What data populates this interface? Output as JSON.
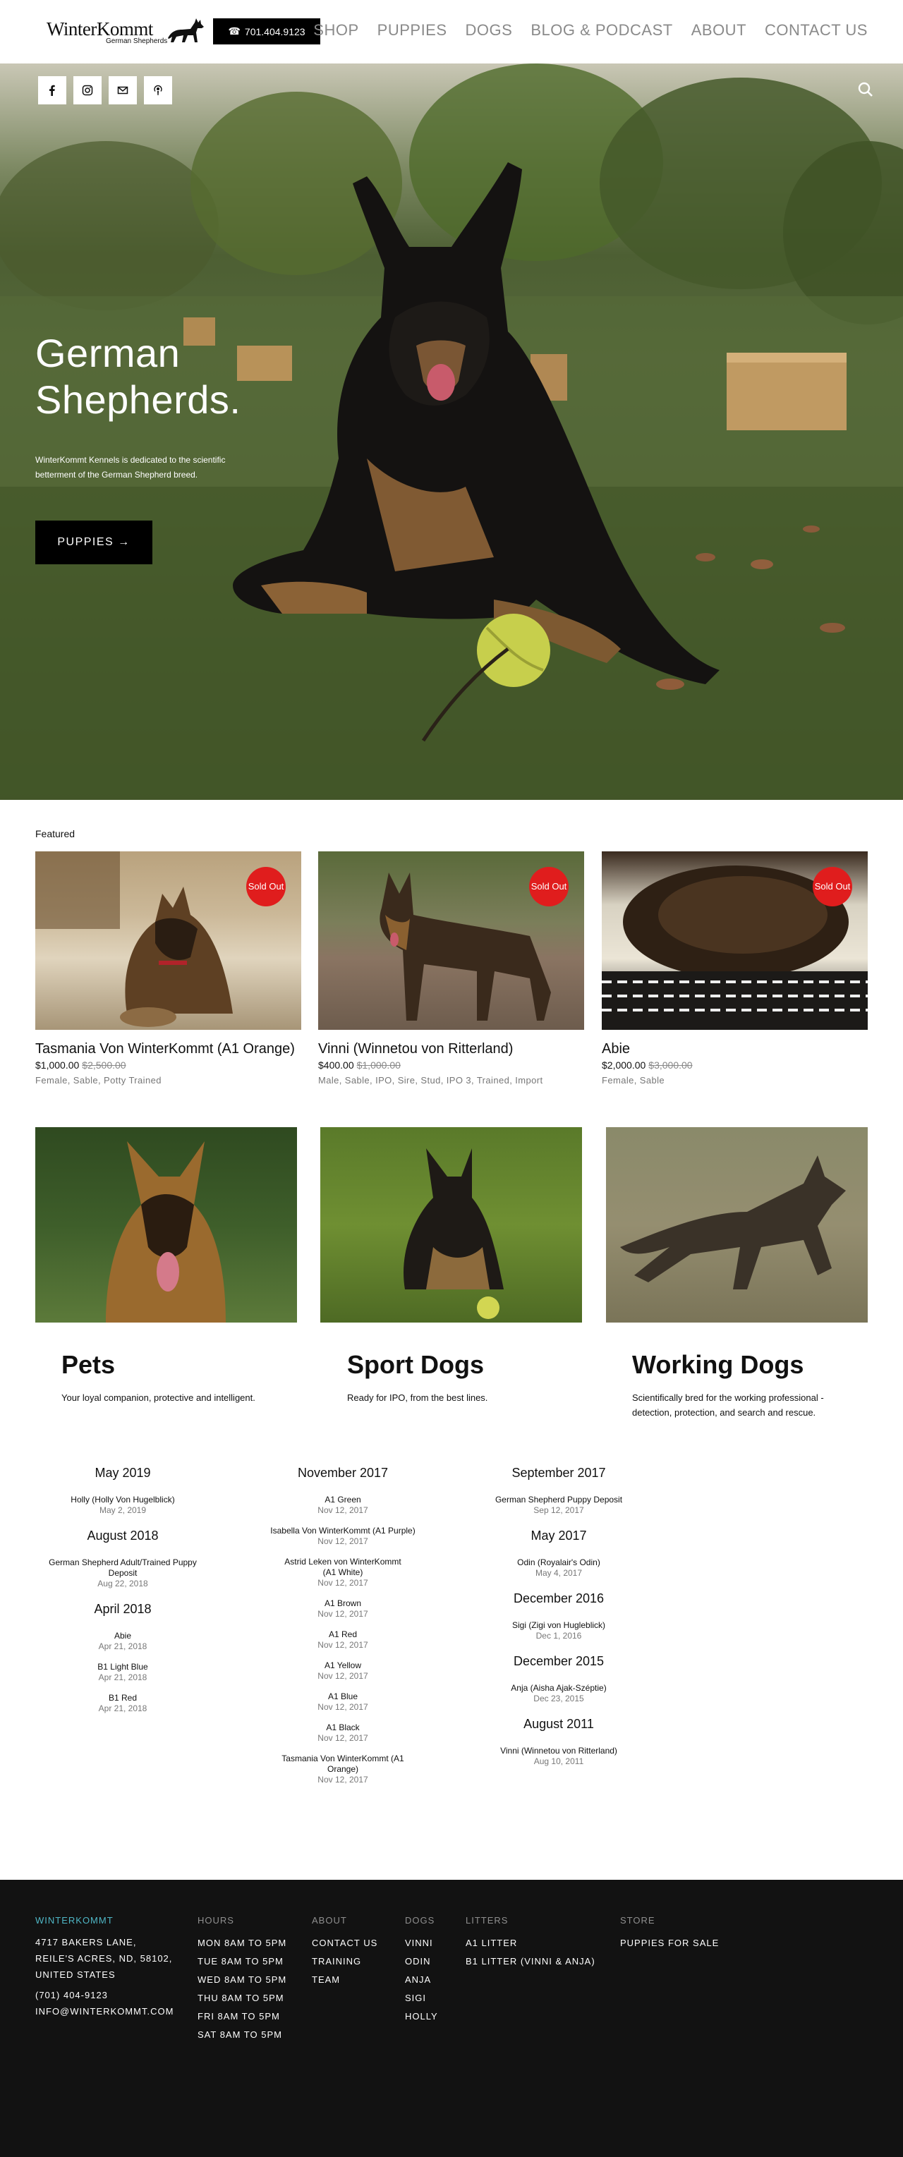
{
  "header": {
    "brand": "WinterKommt",
    "brand_sub": "German Shepherds",
    "phone": "701.404.9123",
    "nav": [
      "SHOP",
      "PUPPIES",
      "DOGS",
      "BLOG & PODCAST",
      "ABOUT",
      "CONTACT US"
    ]
  },
  "hero": {
    "social": [
      "facebook-icon",
      "instagram-icon",
      "email-icon",
      "podcast-icon"
    ],
    "title_line1": "German",
    "title_line2": "Shepherds.",
    "description": "WinterKommt Kennels is dedicated to the scientific betterment of the German Shepherd breed.",
    "button": "PUPPIES →"
  },
  "featured": {
    "label": "Featured",
    "badge": "Sold Out",
    "products": [
      {
        "name": "Tasmania Von WinterKommt (A1 Orange)",
        "price": "$1,000.00",
        "old_price": "$2,500.00",
        "tags": "Female, Sable, Potty Trained"
      },
      {
        "name": "Vinni (Winnetou von Ritterland)",
        "price": "$400.00",
        "old_price": "$1,000.00",
        "tags": "Male, Sable, IPO, Sire, Stud, IPO 3, Trained, Import"
      },
      {
        "name": "Abie",
        "price": "$2,000.00",
        "old_price": "$3,000.00",
        "tags": "Female, Sable"
      }
    ]
  },
  "categories": [
    {
      "title": "Pets",
      "desc": "Your loyal companion, protective and intelligent."
    },
    {
      "title": "Sport Dogs",
      "desc": "Ready for IPO, from the best lines."
    },
    {
      "title": "Working Dogs",
      "desc": "Scientifically bred for the working professional - detection, protection, and search and rescue."
    }
  ],
  "archive": {
    "col1": [
      {
        "month": "May 2019",
        "entries": [
          {
            "t": "Holly (Holly Von Hugelblick)",
            "d": "May 2, 2019"
          }
        ]
      },
      {
        "month": "August 2018",
        "entries": [
          {
            "t": "German Shepherd Adult/Trained Puppy Deposit",
            "d": "Aug 22, 2018"
          }
        ]
      },
      {
        "month": "April 2018",
        "entries": [
          {
            "t": "Abie",
            "d": "Apr 21, 2018"
          },
          {
            "t": "B1 Light Blue",
            "d": "Apr 21, 2018"
          },
          {
            "t": "B1 Red",
            "d": "Apr 21, 2018"
          }
        ]
      }
    ],
    "col2": [
      {
        "month": "November 2017",
        "entries": [
          {
            "t": "A1 Green",
            "d": "Nov 12, 2017"
          },
          {
            "t": "Isabella Von WinterKommt (A1 Purple)",
            "d": "Nov 12, 2017"
          },
          {
            "t": "Astrid Leken von WinterKommt (A1 White)",
            "d": "Nov 12, 2017"
          },
          {
            "t": "A1 Brown",
            "d": "Nov 12, 2017"
          },
          {
            "t": "A1 Red",
            "d": "Nov 12, 2017"
          },
          {
            "t": "A1 Yellow",
            "d": "Nov 12, 2017"
          },
          {
            "t": "A1 Blue",
            "d": "Nov 12, 2017"
          },
          {
            "t": "A1 Black",
            "d": "Nov 12, 2017"
          },
          {
            "t": "Tasmania Von WinterKommt (A1 Orange)",
            "d": "Nov 12, 2017"
          }
        ]
      }
    ],
    "col3": [
      {
        "month": "September 2017",
        "entries": [
          {
            "t": "German Shepherd Puppy Deposit",
            "d": "Sep 12, 2017"
          }
        ]
      },
      {
        "month": "May 2017",
        "entries": [
          {
            "t": "Odin (Royalair's Odin)",
            "d": "May 4, 2017"
          }
        ]
      },
      {
        "month": "December 2016",
        "entries": [
          {
            "t": "Sigi (Zigi von Hugleblick)",
            "d": "Dec 1, 2016"
          }
        ]
      },
      {
        "month": "December 2015",
        "entries": [
          {
            "t": "Anja (Aisha Ajak-Széptie)",
            "d": "Dec 23, 2015"
          }
        ]
      },
      {
        "month": "August 2011",
        "entries": [
          {
            "t": "Vinni (Winnetou von Ritterland)",
            "d": "Aug 10, 2011"
          }
        ]
      }
    ]
  },
  "footer": {
    "brand": "WINTERKOMMT",
    "address1": "4717 BAKERS LANE,",
    "address2": "REILE'S ACRES, ND, 58102,",
    "address3": "UNITED STATES",
    "phone": "(701) 404-9123",
    "email": "INFO@WINTERKOMMT.COM",
    "hours_head": "HOURS",
    "hours": [
      "MON 8AM TO 5PM",
      "TUE 8AM TO 5PM",
      "WED 8AM TO 5PM",
      "THU 8AM TO 5PM",
      "FRI 8AM TO 5PM",
      "SAT 8AM TO 5PM"
    ],
    "about_head": "ABOUT",
    "about": [
      "CONTACT US",
      "TRAINING",
      "TEAM"
    ],
    "dogs_head": "DOGS",
    "dogs": [
      "VINNI",
      "ODIN",
      "ANJA",
      "SIGI",
      "HOLLY"
    ],
    "litters_head": "LITTERS",
    "litters": [
      "A1 LITTER",
      "B1 LITTER (VINNI & ANJA)"
    ],
    "store_head": "STORE",
    "store": [
      "PUPPIES FOR SALE"
    ]
  },
  "colors": {
    "accent": "#4fb7c6",
    "badge": "#e01d1d",
    "footer_bg": "#121212"
  }
}
